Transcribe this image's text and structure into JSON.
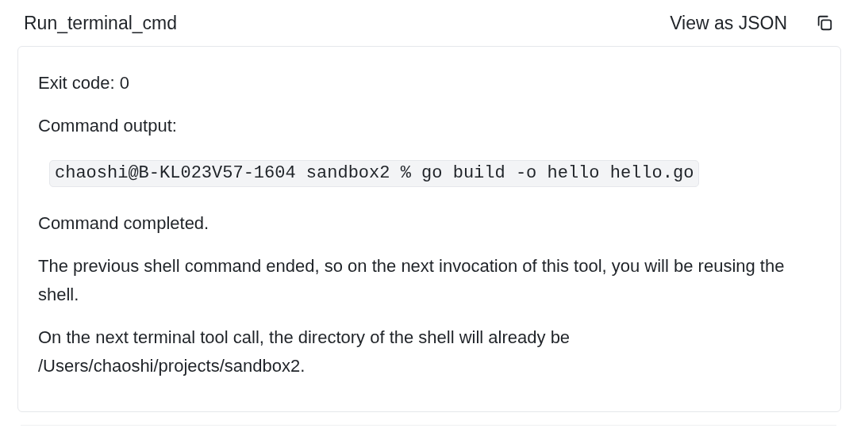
{
  "header": {
    "title": "Run_terminal_cmd",
    "action": "View as JSON"
  },
  "output": {
    "exit_code": "Exit code: 0",
    "output_label": "Command output:",
    "command": "chaoshi@B-KL023V57-1604 sandbox2 % go build -o hello hello.go",
    "paragraphs": [
      "Command completed.",
      "The previous shell command ended, so on the next invocation of this tool, you will be reusing the shell.",
      "On the next terminal tool call, the directory of the shell will already be /Users/chaoshi/projects/sandbox2."
    ]
  }
}
